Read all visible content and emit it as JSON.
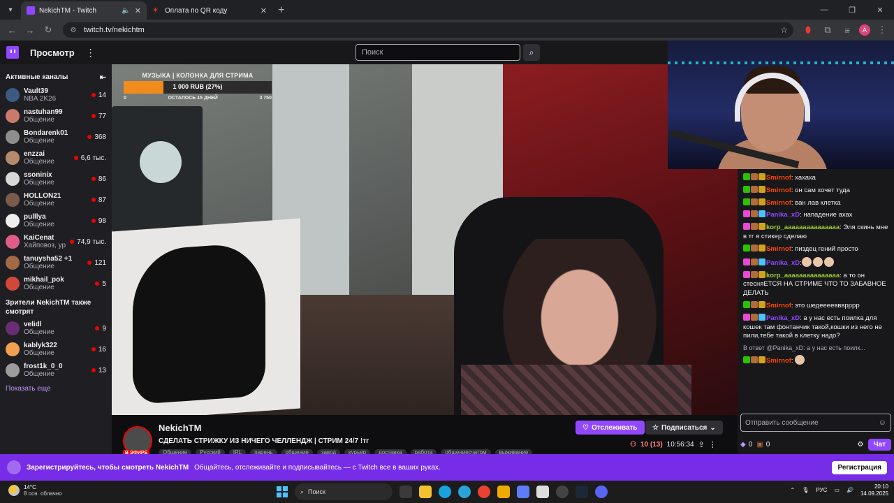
{
  "browser": {
    "tabs": [
      {
        "title": "NekichTM - Twitch",
        "active": true
      },
      {
        "title": "Оплата по QR коду",
        "active": false
      }
    ],
    "url": "twitch.tv/nekichtm"
  },
  "nav": {
    "browse_label": "Просмотр",
    "search_placeholder": "Поиск"
  },
  "sidebar": {
    "active_header": "Активные каналы",
    "channels": [
      {
        "name": "Vault39",
        "category": "NBA 2K26",
        "viewers": "14",
        "color": "#3d5a80"
      },
      {
        "name": "nastuhan99",
        "category": "Общение",
        "viewers": "77",
        "color": "#c97b6b"
      },
      {
        "name": "Bondarenk01",
        "category": "Общение",
        "viewers": "368",
        "color": "#8e8e8e"
      },
      {
        "name": "enzzai",
        "category": "Общение",
        "viewers": "6,6 тыс.",
        "color": "#b58b6e"
      },
      {
        "name": "ssoninix",
        "category": "Общение",
        "viewers": "86",
        "color": "#d8d8d8"
      },
      {
        "name": "HOLLON21",
        "category": "Общение",
        "viewers": "87",
        "color": "#7a5b4b"
      },
      {
        "name": "pulllya",
        "category": "Общение",
        "viewers": "98",
        "color": "#eeeeee"
      },
      {
        "name": "KaiCenat",
        "category": "Хайповоз, уровень 23",
        "viewers": "74,9 тыс.",
        "color": "#e05d8a"
      },
      {
        "name": "tanuysha52 +1",
        "category": "Общение",
        "viewers": "121",
        "color": "#a26b45"
      },
      {
        "name": "mikhail_pok",
        "category": "Общение",
        "viewers": "5",
        "color": "#d1473a"
      }
    ],
    "also_watch_header": "Зрители NekichTM также смотрят",
    "also_watch": [
      {
        "name": "velidl",
        "category": "Общение",
        "viewers": "9",
        "color": "#6a2c74"
      },
      {
        "name": "kablyk322",
        "category": "Общение",
        "viewers": "16",
        "color": "#f0a050"
      },
      {
        "name": "frost1k_0_0",
        "category": "Общение",
        "viewers": "13",
        "color": "#9c9c9c"
      }
    ],
    "show_more": "Показать еще"
  },
  "goal": {
    "title": "МУЗЫКА | КОЛОНКА ДЛЯ СТРИМА",
    "progress_text": "1 000 RUB (27%)",
    "progress_percent": 27,
    "start": "0",
    "remaining": "ОСТАЛОСЬ 15 ДНЕЙ",
    "target": "3 750"
  },
  "stream": {
    "streamer": "NekichTM",
    "live_label": "В ЭФИРЕ",
    "title": "СДЕЛАТЬ СТРИЖКУ ИЗ НИЧЕГО ЧЕЛЛЕНДЖ | СТРИМ 24/7 !тг",
    "tags": [
      "Общение",
      "Русский",
      "IRL",
      "парень",
      "общение",
      "завод",
      "курьер",
      "доставка",
      "работа",
      "общениесчатом",
      "выживание"
    ],
    "follow_label": "Отслеживать",
    "subscribe_label": "Подписаться",
    "viewers": "10 (13)",
    "uptime": "10:56:34"
  },
  "chat": {
    "messages": [
      {
        "user": "Smirnof",
        "color": "#ff4500",
        "badges": [
          "#2dc100",
          "#b26b3a",
          "#d2a21f"
        ],
        "text": ": хахаха"
      },
      {
        "user": "Smirnof",
        "color": "#ff4500",
        "badges": [
          "#2dc100",
          "#b26b3a",
          "#d2a21f"
        ],
        "text": ": он сам хочет туда"
      },
      {
        "user": "Smirnof",
        "color": "#ff4500",
        "badges": [
          "#2dc100",
          "#b26b3a",
          "#d2a21f"
        ],
        "text": ": ван лав клетка"
      },
      {
        "user": "Panika_xD",
        "color": "#9146ff",
        "badges": [
          "#e84ad6",
          "#b26b3a",
          "#4cc2ff"
        ],
        "text": ": нападение ахах"
      },
      {
        "user": "korp_aaaaaaaaaaaaaaa",
        "color": "#9acd32",
        "badges": [
          "#e84ad6",
          "#b26b3a",
          "#d2a21f"
        ],
        "text": ": Эля скинь мне в тг я стикер сделаю"
      },
      {
        "user": "Smirnof",
        "color": "#ff4500",
        "badges": [
          "#2dc100",
          "#b26b3a",
          "#d2a21f"
        ],
        "text": ": пиздец гений просто"
      },
      {
        "user": "Panika_xD",
        "color": "#9146ff",
        "badges": [
          "#e84ad6",
          "#b26b3a",
          "#4cc2ff"
        ],
        "text": ":"
      },
      {
        "user": "korp_aaaaaaaaaaaaaaa",
        "color": "#9acd32",
        "badges": [
          "#e84ad6",
          "#b26b3a",
          "#d2a21f"
        ],
        "text": ": а то он стесняЕТСЯ НА СТРИМЕ ЧТО ТО ЗАБАВНОЕ ДЕЛАТЬ"
      },
      {
        "user": "Smirnof",
        "color": "#ff4500",
        "badges": [
          "#2dc100",
          "#b26b3a",
          "#d2a21f"
        ],
        "text": ": это шедееееввврррр"
      },
      {
        "user": "Panika_xD",
        "color": "#9146ff",
        "badges": [
          "#e84ad6",
          "#b26b3a",
          "#4cc2ff"
        ],
        "text": ": а у нас есть поилка для кошек там фонтанчик такой,кошки из него не пили,тебе такой в клетку надо?"
      }
    ],
    "reply_line": "В ответ @Panika_xD: а у нас есть поилк...",
    "last_user": "Smirnof",
    "input_placeholder": "Отправить сообщение",
    "points_a": "0",
    "points_b": "0",
    "send_label": "Чат"
  },
  "banner": {
    "strong": "Зарегистрируйтесь, чтобы смотреть NekichTM",
    "text": "Общайтесь, отслеживайте и подписывайтесь — с Twitch все в ваших руках.",
    "button": "Регистрация"
  },
  "taskbar": {
    "temp": "14°C",
    "weather": "8 осн. облачно",
    "search": "Поиск",
    "lang": "РУС",
    "time": "20:10",
    "date": "14.09.2025"
  }
}
